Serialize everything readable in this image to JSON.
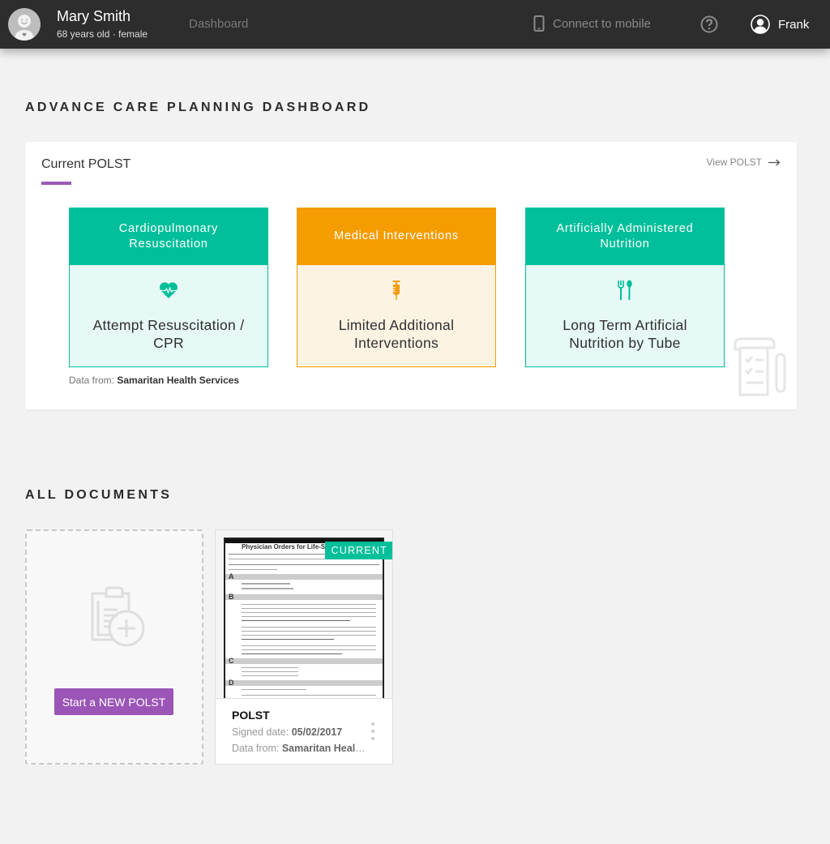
{
  "header": {
    "patient_name": "Mary Smith",
    "patient_meta": "68 years old · female",
    "nav_dashboard": "Dashboard",
    "connect_mobile": "Connect to mobile",
    "help_icon": "question-circle-icon",
    "user_name": "Frank"
  },
  "page": {
    "title": "ADVANCE CARE PLANNING DASHBOARD"
  },
  "current_polst": {
    "title": "Current POLST",
    "view_link": "View POLST",
    "tiles": [
      {
        "header": "Cardiopulmonary Resuscitation",
        "icon": "heart-pulse-icon",
        "value": "Attempt Resuscitation / CPR",
        "color": "#00bf9a"
      },
      {
        "header": "Medical Interventions",
        "icon": "syringe-icon",
        "value": "Limited Additional Interventions",
        "color": "#f59c00"
      },
      {
        "header": "Artificially Administered Nutrition",
        "icon": "fork-spoon-icon",
        "value": "Long Term Artificial Nutrition by Tube",
        "color": "#00bf9a"
      }
    ],
    "data_from_label": "Data from:",
    "data_from_value": "Samaritan Health Services"
  },
  "documents": {
    "title": "ALL DOCUMENTS",
    "new_button": "Start a NEW POLST",
    "items": [
      {
        "badge": "CURRENT",
        "name": "POLST",
        "signed_label": "Signed date:",
        "signed_value": "05/02/2017",
        "data_from_label": "Data from:",
        "data_from_value": "Samaritan Health Services",
        "thumbnail_title": "Physician Orders for Life-Sustaining Treatment"
      }
    ]
  },
  "colors": {
    "accent_purple": "#9b59b6",
    "green": "#00bf9a",
    "orange": "#f59c00",
    "topbar": "#2d2d2d"
  }
}
